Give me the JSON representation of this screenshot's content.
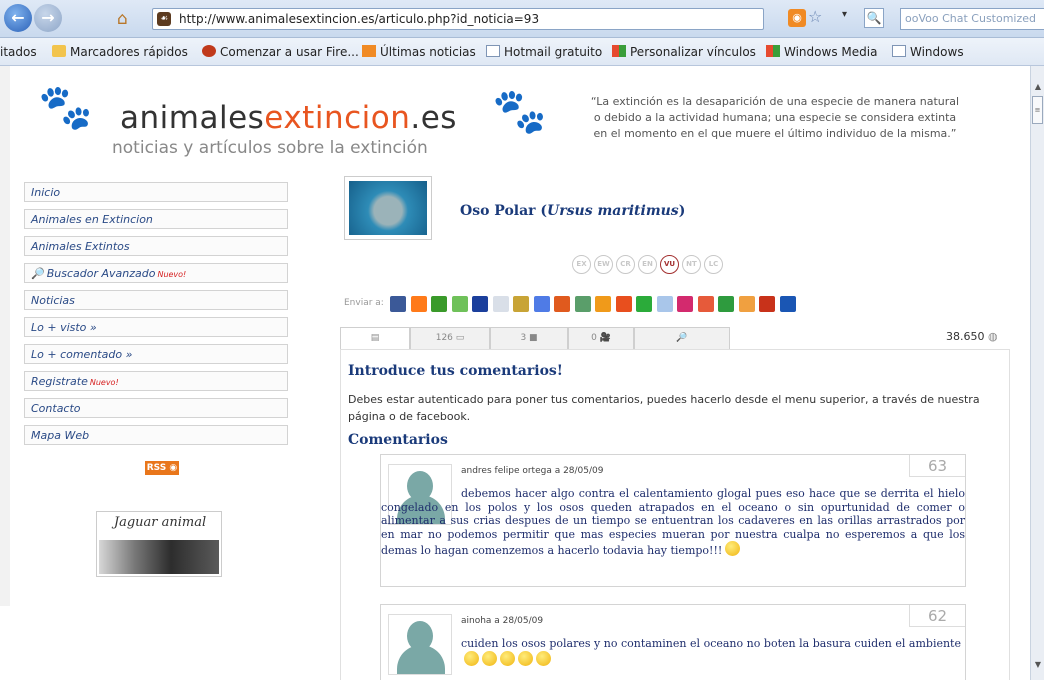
{
  "browser": {
    "url": "http://www.animalesextincion.es/articulo.php?id_noticia=93",
    "search_placeholder": "ooVoo Chat Customized",
    "bookmarks": [
      "itados",
      "Marcadores rápidos",
      "Comenzar a usar Fire...",
      "Últimas noticias",
      "Hotmail gratuito",
      "Personalizar vínculos",
      "Windows Media",
      "Windows"
    ]
  },
  "header": {
    "logo_main": "animales",
    "logo_accent": "extincion",
    "logo_tld": ".es",
    "tagline": "noticias y artículos sobre la extinción",
    "quote": "“La extinción es la desaparición de una especie de manera natural o debido a la actividad humana; una especie se considera extinta en el momento en el que muere el último individuo de la misma.”"
  },
  "sidebar": {
    "items": [
      "Inicio",
      "Animales en Extincion",
      "Animales Extintos",
      "Buscador Avanzado",
      "Noticias",
      "Lo + visto »",
      "Lo + comentado »",
      "Registrate",
      "Contacto",
      "Mapa Web"
    ],
    "nuevo_label": "Nuevo!",
    "rss_label": "RSS",
    "widget_title": "Jaguar animal"
  },
  "article": {
    "title_common": "Oso Polar (",
    "title_scientific": "Ursus maritimus",
    "title_close": ")",
    "status_codes": [
      "EX",
      "EW",
      "CR",
      "EN",
      "VU",
      "NT",
      "LC"
    ],
    "status_active": "VU",
    "share_label": "Enviar a:",
    "tab_counts": [
      "126",
      "3",
      "0"
    ],
    "views": "38.650"
  },
  "comments_section": {
    "intro_title": "Introduce tus comentarios!",
    "intro_text": "Debes estar autenticado para poner tus comentarios, puedes hacerlo desde el menu superior, a través de nuestra página o de facebook.",
    "title": "Comentarios",
    "items": [
      {
        "meta": "andres felipe ortega a 28/05/09",
        "number": "63",
        "text": "debemos hacer algo contra el calentamiento glogal pues eso hace que se derrita el hielo congelado en los polos y los osos queden atrapados en el oceano o sin opurtunidad de comer o alimentar a sus crias despues de un tiempo se entuentran los cadaveres en las orillas arrastrados por en mar no podemos permitir que mas especies mueran por nuestra cualpa no esperemos a que los demas lo hagan comenzemos a hacerlo todavia hay tiempo!!!"
      },
      {
        "meta": "ainoha a 28/05/09",
        "number": "62",
        "text": "cuiden los osos polares y no contaminen el oceano no boten la basura cuiden el ambiente"
      }
    ]
  },
  "colors": {
    "accent": "#e85520",
    "link": "#2a4a86",
    "heading": "#1a3a7a",
    "vu": "#a33030"
  }
}
